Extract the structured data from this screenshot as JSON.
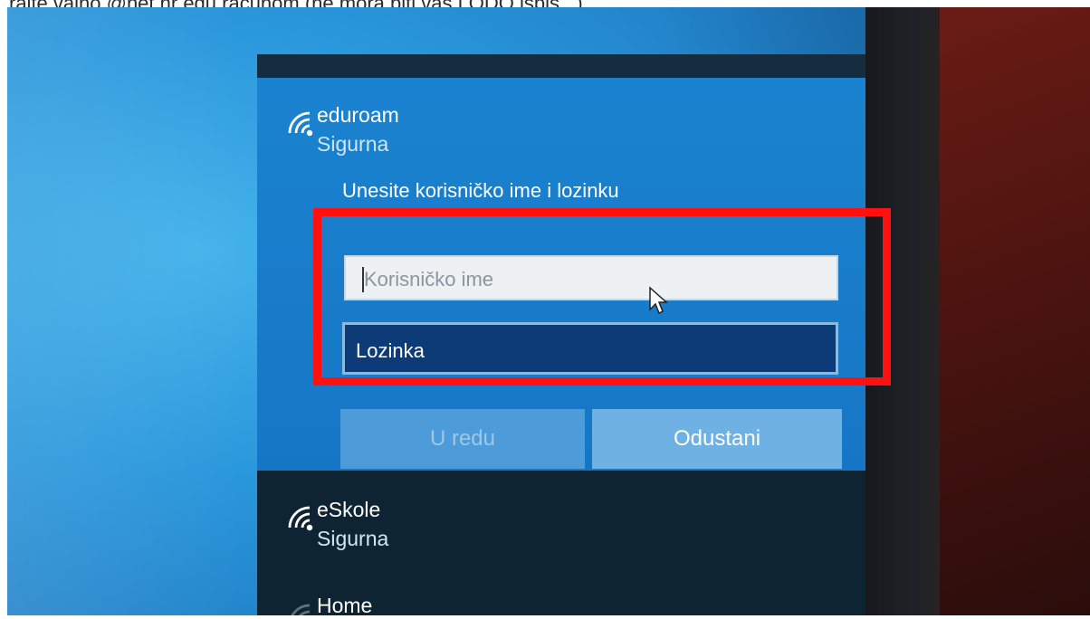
{
  "top_cut_text": "rajte vajno @net.hr edu računom (ne mora biti vaš LODO ispis...)",
  "networks": [
    {
      "name": "eduroam",
      "status": "Sigurna"
    },
    {
      "name": "eSkole",
      "status": "Sigurna"
    },
    {
      "name": "Home",
      "status": ""
    }
  ],
  "login": {
    "prompt": "Unesite korisničko ime i lozinku",
    "username_placeholder": "Korisničko ime",
    "password_placeholder": "Lozinka"
  },
  "buttons": {
    "ok": "U redu",
    "cancel": "Odustani"
  },
  "colors": {
    "highlight": "#ff1111",
    "selected_network": "#1a83d0",
    "panel": "#0f2433"
  },
  "icons": {
    "network": "wifi-icon",
    "cursor": "mouse-pointer-icon"
  }
}
